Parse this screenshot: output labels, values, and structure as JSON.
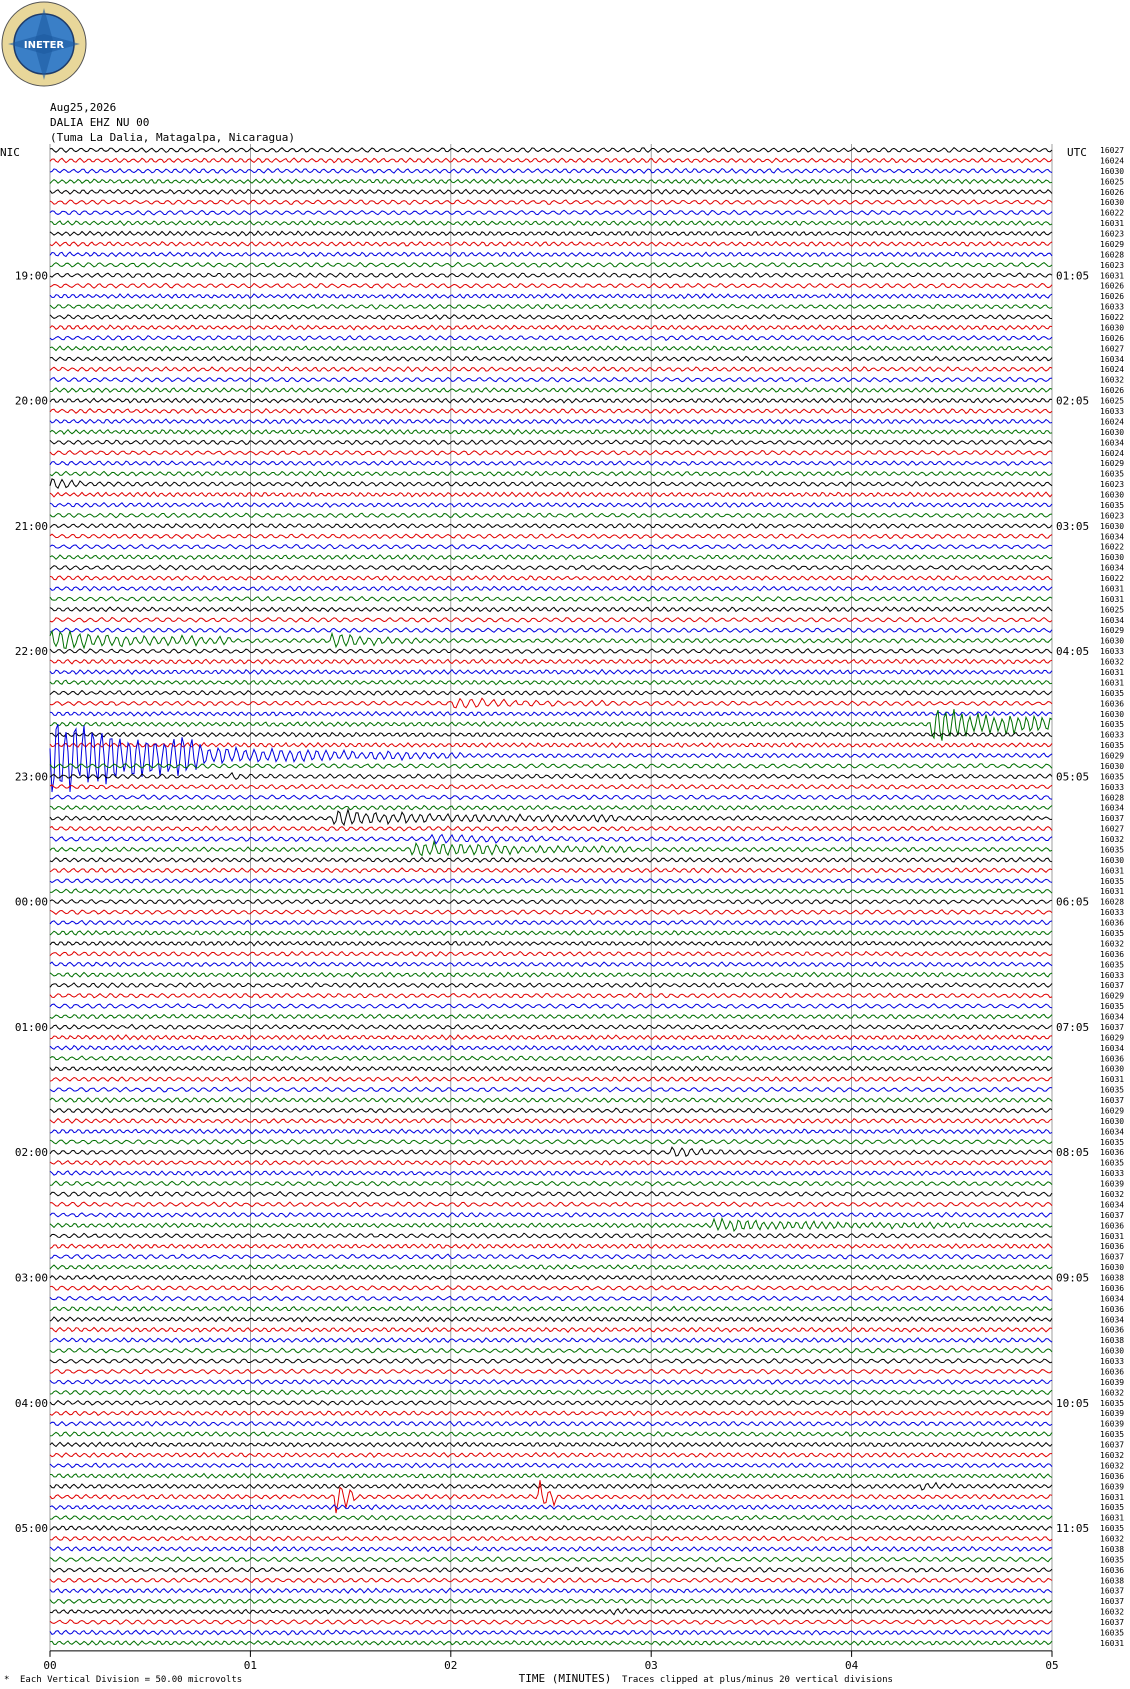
{
  "header": {
    "logo_text": "INETER",
    "date": "Aug25,2026",
    "station": "DALIA EHZ NU 00",
    "location": "(Tuma La Dalia, Matagalpa, Nicaragua)",
    "left_tz": "NIC",
    "right_tz": "UTC"
  },
  "footer": {
    "scale_text": "Each Vertical Division =   50.00 microvolts",
    "clip_text": "Traces clipped at plus/minus 20 vertical divisions"
  },
  "colors": {
    "traces": [
      "#000000",
      "#e00000",
      "#0000e0",
      "#007000"
    ],
    "grid": "#888888"
  },
  "chart_data": {
    "type": "line",
    "title": "",
    "xlabel": "TIME (MINUTES)",
    "ylabel": "",
    "x_ticks": [
      "00",
      "01",
      "02",
      "03",
      "04",
      "05"
    ],
    "xlim": [
      0,
      5
    ],
    "traces_per_hour": 12,
    "trace_count": 144,
    "left_hour_labels": [
      "19:00",
      "20:00",
      "21:00",
      "22:00",
      "23:00",
      "00:00",
      "01:00",
      "02:00",
      "03:00",
      "04:00",
      "05:00"
    ],
    "right_hour_labels": [
      "01:05",
      "02:05",
      "03:05",
      "04:05",
      "05:05",
      "06:05",
      "07:05",
      "08:05",
      "09:05",
      "10:05",
      "11:05"
    ],
    "first_labeled_trace": 12,
    "trace_values": [
      "16027",
      "16024",
      "16030",
      "16025",
      "16026",
      "16030",
      "16022",
      "16031",
      "16023",
      "16029",
      "16028",
      "16023",
      "16031",
      "16026",
      "16026",
      "16033",
      "16022",
      "16030",
      "16026",
      "16027",
      "16034",
      "16024",
      "16032",
      "16026",
      "16025",
      "16033",
      "16024",
      "16030",
      "16034",
      "16024",
      "16029",
      "16035",
      "16023",
      "16030",
      "16035",
      "16023",
      "16030",
      "16034",
      "16022",
      "16030",
      "16034",
      "16022",
      "16031",
      "16031",
      "16025",
      "16034",
      "16029",
      "16030",
      "16033",
      "16032",
      "16031",
      "16031",
      "16035",
      "16036",
      "16030",
      "16035",
      "16033",
      "16035",
      "16029",
      "16030",
      "16035",
      "16033",
      "16028",
      "16034",
      "16037",
      "16027",
      "16032",
      "16035",
      "16030",
      "16031",
      "16035",
      "16031",
      "16028",
      "16033",
      "16036",
      "16035",
      "16032",
      "16036",
      "16035",
      "16033",
      "16037",
      "16029",
      "16035",
      "16034",
      "16037",
      "16029",
      "16034",
      "16036",
      "16030",
      "16031",
      "16035",
      "16037",
      "16029",
      "16030",
      "16034",
      "16035",
      "16036",
      "16035",
      "16033",
      "16039",
      "16032",
      "16034",
      "16037",
      "16036",
      "16031",
      "16036",
      "16037",
      "16030",
      "16038",
      "16036",
      "16034",
      "16036",
      "16034",
      "16036",
      "16038",
      "16030",
      "16033",
      "16036",
      "16039",
      "16032",
      "16035",
      "16039",
      "16039",
      "16035",
      "16037",
      "16032",
      "16032",
      "16036",
      "16039",
      "16031",
      "16035",
      "16031",
      "16035",
      "16032",
      "16038",
      "16035",
      "16036",
      "16038",
      "16037",
      "16037",
      "16032",
      "16037",
      "16035",
      "16031"
    ],
    "events": [
      {
        "trace": 32,
        "start": 0.0,
        "end": 0.3,
        "amp": 7
      },
      {
        "trace": 47,
        "start": 0.0,
        "end": 0.9,
        "amp": 12
      },
      {
        "trace": 47,
        "start": 1.4,
        "end": 1.85,
        "amp": 9
      },
      {
        "trace": 53,
        "start": 2.0,
        "end": 2.8,
        "amp": 7
      },
      {
        "trace": 58,
        "start": 0.0,
        "end": 0.75,
        "amp": 55
      },
      {
        "trace": 58,
        "start": 0.75,
        "end": 1.9,
        "amp": 12
      },
      {
        "trace": 58,
        "start": 1.9,
        "end": 2.3,
        "amp": 5
      },
      {
        "trace": 55,
        "start": 4.4,
        "end": 5.0,
        "amp": 24
      },
      {
        "trace": 60,
        "start": 0.9,
        "end": 1.0,
        "amp": 6
      },
      {
        "trace": 64,
        "start": 1.4,
        "end": 2.7,
        "amp": 10
      },
      {
        "trace": 64,
        "start": 2.7,
        "end": 3.3,
        "amp": 5
      },
      {
        "trace": 66,
        "start": 1.9,
        "end": 3.1,
        "amp": 6
      },
      {
        "trace": 67,
        "start": 1.8,
        "end": 2.9,
        "amp": 10
      },
      {
        "trace": 96,
        "start": 3.1,
        "end": 3.5,
        "amp": 7
      },
      {
        "trace": 103,
        "start": 3.3,
        "end": 4.6,
        "amp": 8
      },
      {
        "trace": 129,
        "start": 1.42,
        "end": 1.52,
        "amp": 24
      },
      {
        "trace": 129,
        "start": 2.43,
        "end": 2.53,
        "amp": 22
      },
      {
        "trace": 128,
        "start": 4.35,
        "end": 4.6,
        "amp": 6
      },
      {
        "trace": 140,
        "start": 2.8,
        "end": 3.0,
        "amp": 6
      }
    ]
  }
}
